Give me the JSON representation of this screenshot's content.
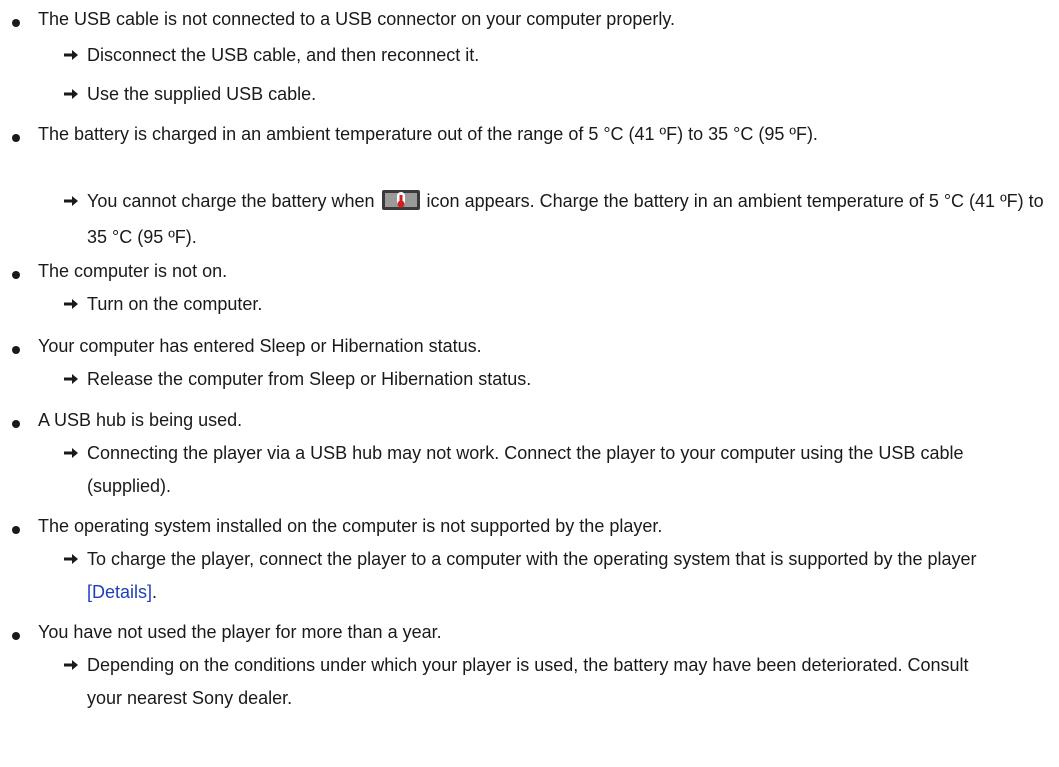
{
  "items": [
    {
      "cause": "The USB cable is not connected to a USB connector on your computer properly.",
      "remedies": [
        "Disconnect the USB cable, and then reconnect it.",
        "Use the supplied USB cable."
      ]
    },
    {
      "cause": "The battery is charged in an ambient temperature out of the range of 5 °C (41 ºF) to 35 °C (95 ºF).",
      "remedies": [
        {
          "before_icon": "You cannot charge the battery when ",
          "icon": "battery-temperature-icon",
          "after_icon": " icon appears. Charge the battery in an ambient temperature of 5 °C (41 ºF) to 35 °C (95 ºF)."
        }
      ]
    },
    {
      "cause": "The computer is not on.",
      "remedies": [
        "Turn on the computer."
      ]
    },
    {
      "cause": "Your computer has entered Sleep or Hibernation status.",
      "remedies": [
        "Release the computer from Sleep or Hibernation status."
      ]
    },
    {
      "cause": "A USB hub is being used.",
      "remedies": [
        "Connecting the player via a USB hub may not work. Connect the player to your computer using the USB cable (supplied)."
      ]
    },
    {
      "cause": "The operating system installed on the computer is not supported by the player.",
      "remedies": [
        {
          "before_link": "To charge the player, connect the player to a computer with the operating system that is supported by the player ",
          "link": "[Details]",
          "after_link": "."
        }
      ]
    },
    {
      "cause": "You have not used the player for more than a year.",
      "remedies": [
        "Depending on the conditions under which your player is used, the battery may have been deteriorated. Consult your nearest Sony dealer."
      ]
    }
  ],
  "colors": {
    "text": "#1a1a1a",
    "link": "#1f3fb8"
  },
  "icons": {
    "bullet": "bullet-dot",
    "arrow": "right-arrow-icon"
  }
}
